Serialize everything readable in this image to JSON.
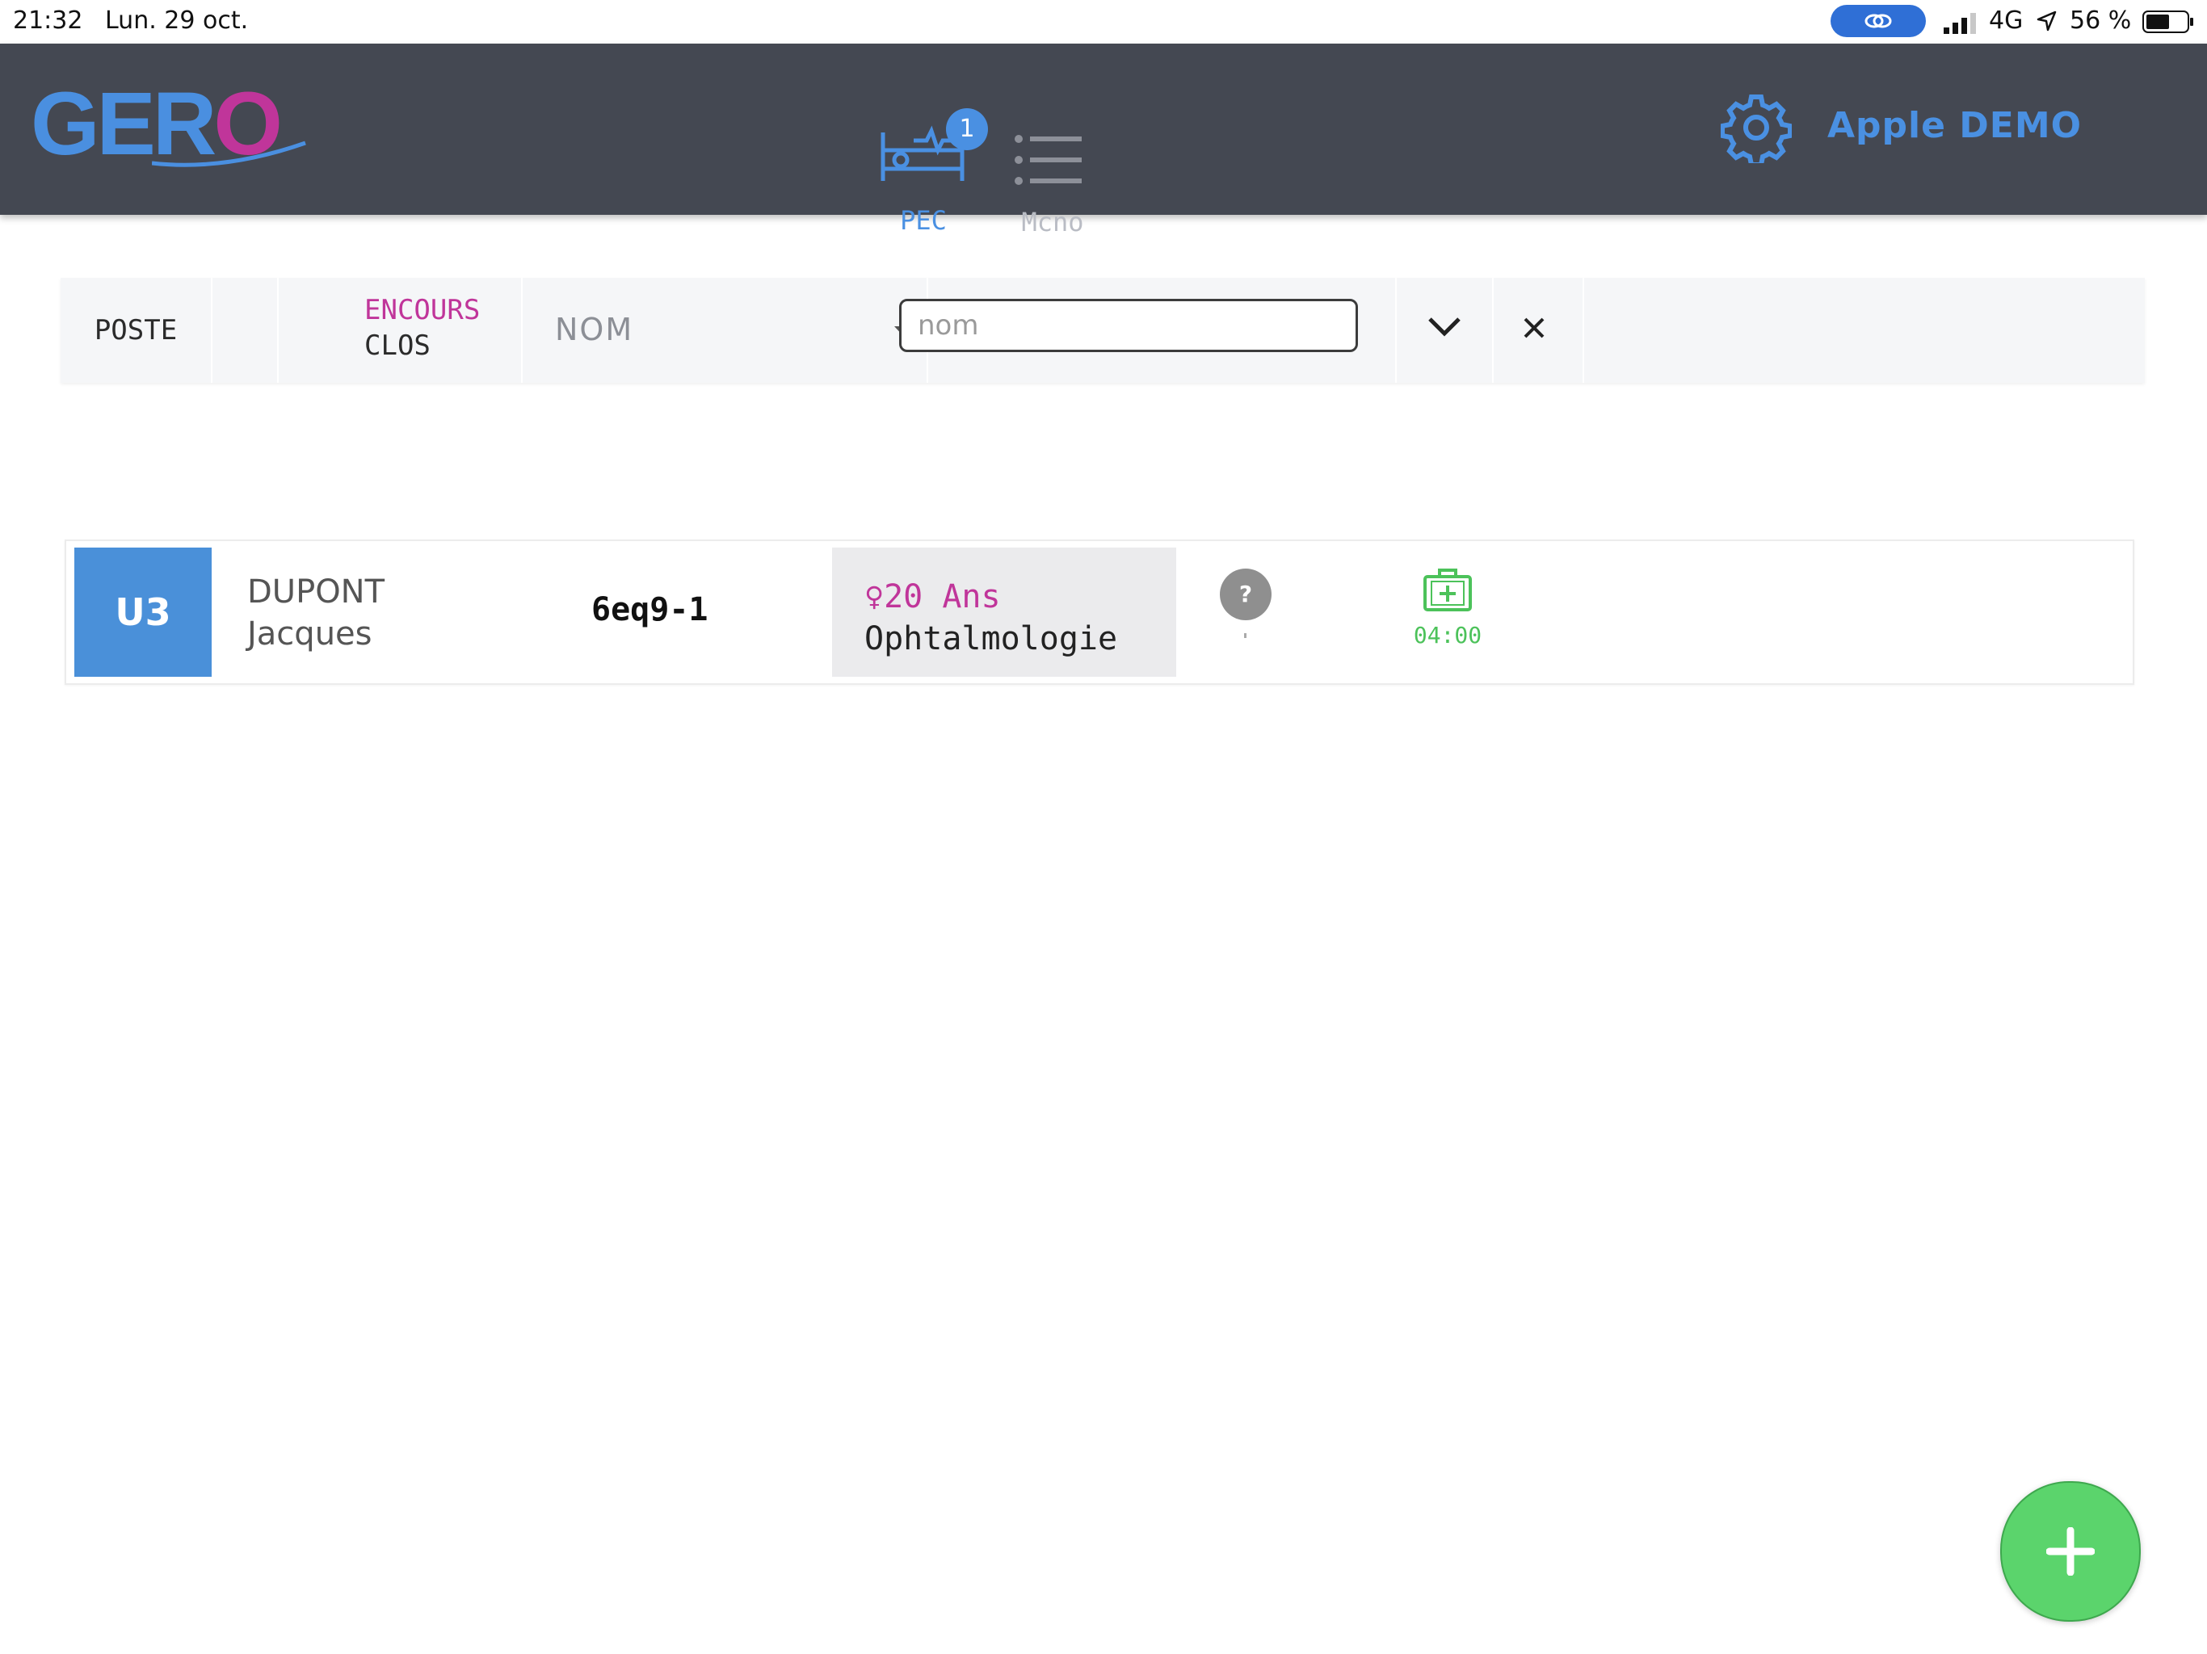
{
  "status_bar": {
    "time": "21:32",
    "date": "Lun. 29 oct.",
    "network": "4G",
    "battery": "56 %"
  },
  "navbar": {
    "logo": "GERO",
    "tabs": [
      {
        "label": "PEC",
        "badge": "1",
        "icon": "hospital-bed-icon",
        "active": true
      },
      {
        "label": "Mcno",
        "icon": "list-icon",
        "active": false
      }
    ],
    "settings_icon": "gear-icon",
    "user": "Apple DEMO"
  },
  "filters": {
    "poste": "POSTE",
    "status_active": "ENCOURS",
    "status_closed": "CLOS",
    "sort_field": "NOM",
    "search_placeholder": "nom",
    "search_value": ""
  },
  "patients": [
    {
      "unit": "U3",
      "last_name": "DUPONT",
      "first_name": "Jacques",
      "id": "6eq9-1",
      "age": "♀20 Ans",
      "specialty": "Ophtalmologie",
      "status_icon": "question-icon",
      "timer": "04:00"
    }
  ],
  "colors": {
    "accent": "#4a90e2",
    "magenta": "#c0359a",
    "green": "#5bd46c",
    "navbar": "#444852"
  }
}
